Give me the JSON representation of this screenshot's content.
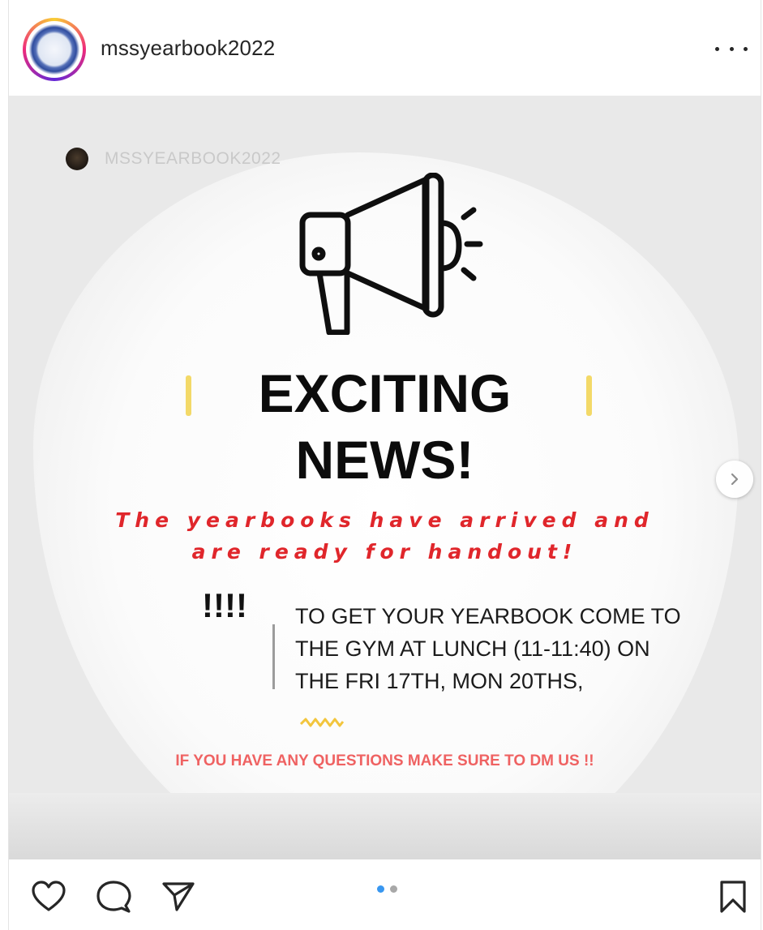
{
  "post": {
    "username": "mssyearbook2022"
  },
  "image": {
    "watermark": "MSSYEARBOOK2022",
    "headline": [
      "EXCITING",
      "NEWS!"
    ],
    "subhead": [
      "The yearbooks have arrived and",
      "are ready for handout!"
    ],
    "bangs": "!!!!",
    "info": [
      "TO GET YOUR YEARBOOK COME TO",
      "THE GYM AT LUNCH (11-11:40) ON",
      "THE FRI 17TH, MON 20THS,"
    ],
    "question": "IF YOU HAVE ANY QUESTIONS MAKE SURE TO DM US !!"
  },
  "carousel": {
    "current_index": 1,
    "total": 2
  },
  "colors": {
    "accent_red": "#e0262b",
    "question_pink": "#ef6262",
    "highlight_yellow": "#f3d968",
    "dot_active": "#3897f0",
    "dot_inactive": "#a8a8a8"
  },
  "icons": [
    "more-options-icon",
    "megaphone-icon",
    "chevron-right-icon",
    "heart-icon",
    "comment-icon",
    "share-icon",
    "bookmark-icon"
  ]
}
